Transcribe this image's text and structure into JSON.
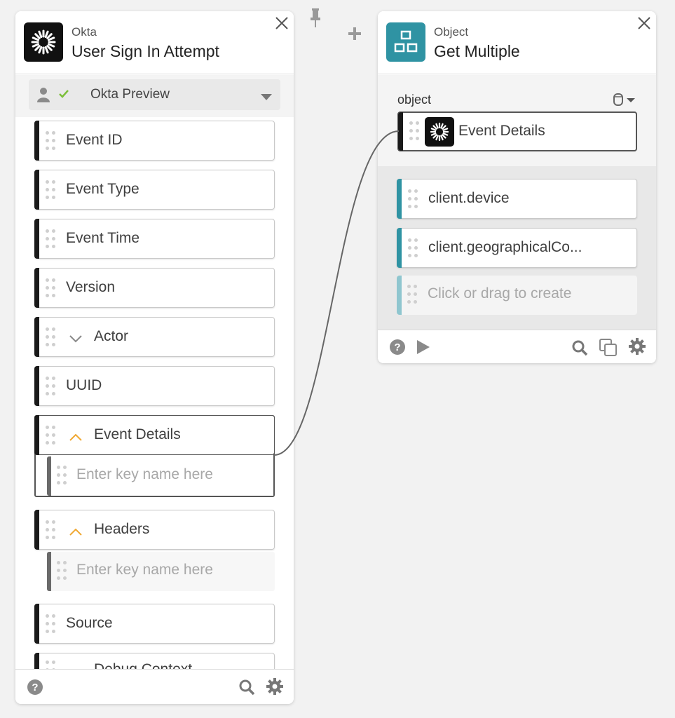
{
  "left_card": {
    "kind": "Okta",
    "title": "User Sign In Attempt",
    "connection": {
      "label": "Okta Preview",
      "icons": [
        "user-icon",
        "check-icon",
        "caret-down-icon"
      ]
    },
    "fields": [
      {
        "label": "Event ID"
      },
      {
        "label": "Event Type"
      },
      {
        "label": "Event Time"
      },
      {
        "label": "Version"
      },
      {
        "label": "Actor",
        "expander": "chevron-down-icon"
      },
      {
        "label": "UUID"
      },
      {
        "label": "Event Details",
        "expander": "chevron-up-icon",
        "child_placeholder": "Enter key name here"
      },
      {
        "label": "Headers",
        "expander": "chevron-up-icon",
        "child_placeholder": "Enter key name here"
      },
      {
        "label": "Source"
      },
      {
        "label": "Debug Context",
        "expander": "chevron-up-icon"
      }
    ],
    "footer_icons": [
      "help-icon",
      "search-icon",
      "gear-icon"
    ]
  },
  "toolbar": {
    "icons": [
      "pin-icon",
      "plus-icon"
    ]
  },
  "right_card": {
    "kind": "Object",
    "title": "Get Multiple",
    "input_label": "object",
    "input_value": "Event Details",
    "outputs": [
      {
        "label": "client.device"
      },
      {
        "label": "client.geographicalCo..."
      }
    ],
    "create_placeholder": "Click or drag to create",
    "footer_icons": [
      "help-icon",
      "play-icon",
      "search-icon",
      "copy-icon",
      "gear-icon"
    ]
  },
  "colors": {
    "accent_teal": "#2f93a3",
    "check_green": "#7cbf3a",
    "chevron_orange": "#f0a832",
    "dark_bar": "#1a1a1a"
  }
}
